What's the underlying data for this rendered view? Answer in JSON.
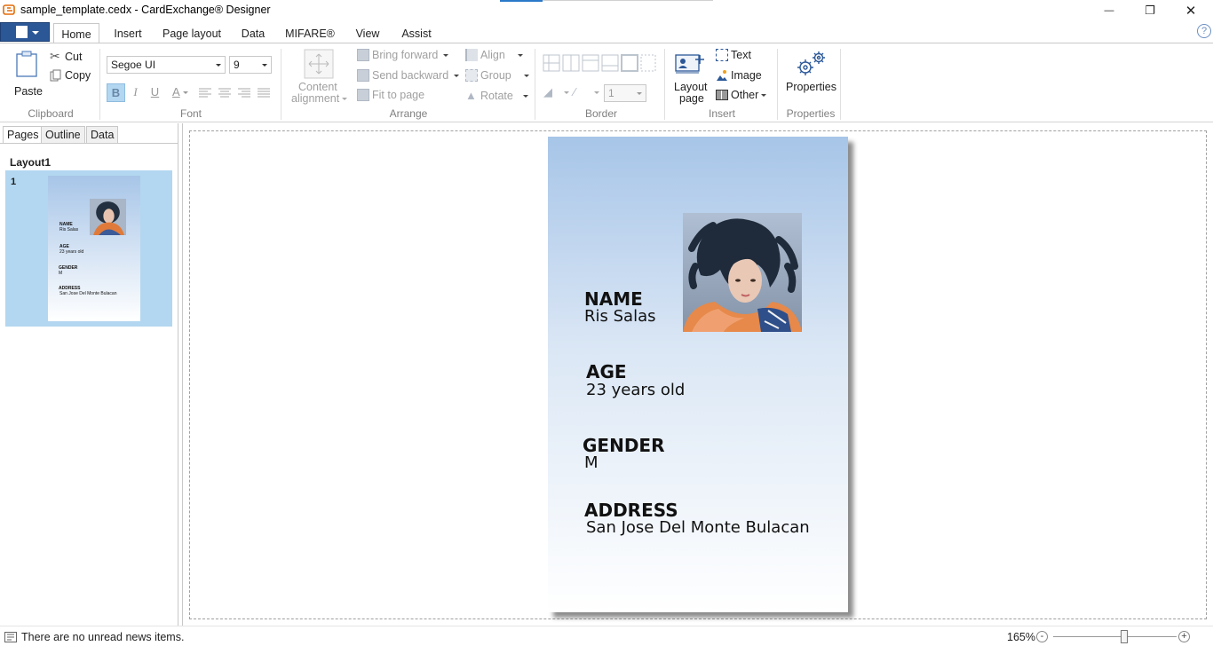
{
  "window": {
    "title": "sample_template.cedx - CardExchange® Designer",
    "minimize_glyph": "—",
    "maximize_glyph": "❐",
    "close_glyph": "✕"
  },
  "ribbon_tabs": [
    "Home",
    "Insert",
    "Page layout",
    "Data",
    "MIFARE®",
    "View",
    "Assist"
  ],
  "active_tab": "Home",
  "help_glyph": "?",
  "clipboard": {
    "paste": "Paste",
    "cut": "Cut",
    "copy": "Copy",
    "group_label": "Clipboard"
  },
  "font": {
    "family": "Segoe UI",
    "size": "9",
    "bold": "B",
    "italic": "I",
    "underline": "U",
    "color": "A",
    "group_label": "Font"
  },
  "content_alignment": {
    "line1": "Content",
    "line2": "alignment"
  },
  "arrange": {
    "bring_forward": "Bring forward",
    "send_backward": "Send backward",
    "fit_to_page": "Fit to page",
    "align": "Align",
    "group": "Group",
    "rotate": "Rotate",
    "group_label": "Arrange"
  },
  "border": {
    "width_value": "1",
    "group_label": "Border"
  },
  "insert": {
    "layout_page_line1": "Layout",
    "layout_page_line2": "page",
    "text": "Text",
    "image": "Image",
    "other": "Other",
    "group_label": "Insert"
  },
  "properties": {
    "button": "Properties",
    "group_label": "Properties"
  },
  "left_panel": {
    "tabs": [
      "Pages",
      "Outline",
      "Data"
    ],
    "active_tab": "Pages",
    "layout_name": "Layout1",
    "page_number": "1"
  },
  "card": {
    "fields": [
      {
        "label": "NAME",
        "value": "Ris Salas"
      },
      {
        "label": "AGE",
        "value": "23 years old"
      },
      {
        "label": "GENDER",
        "value": "M"
      },
      {
        "label": "ADDRESS",
        "value": "San Jose Del Monte Bulacan"
      }
    ],
    "gradient_top": "#a7c5e8",
    "gradient_bottom": "#ffffff"
  },
  "status": {
    "news": "There are no unread news items.",
    "zoom": "165%",
    "zoom_out": "-",
    "zoom_in": "+"
  },
  "colors": {
    "file_button": "#2b5797",
    "selection": "#b3d7f0"
  }
}
